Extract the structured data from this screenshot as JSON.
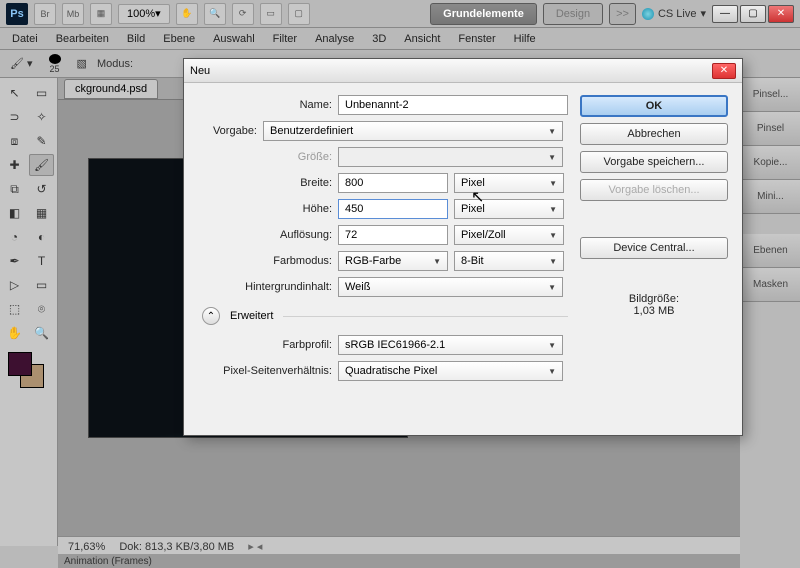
{
  "app": {
    "logo": "Ps",
    "br": "Br",
    "mb": "Mb",
    "zoom": "100%",
    "pill_main": "Grundelemente",
    "pill_design": "Design",
    "chev": ">>",
    "cslive": "CS Live"
  },
  "menus": {
    "datei": "Datei",
    "bearbeiten": "Bearbeiten",
    "bild": "Bild",
    "ebene": "Ebene",
    "auswahl": "Auswahl",
    "filter": "Filter",
    "analyse": "Analyse",
    "dreiD": "3D",
    "ansicht": "Ansicht",
    "fenster": "Fenster",
    "hilfe": "Hilfe"
  },
  "opts": {
    "brush_size": "25",
    "mode": "Modus:"
  },
  "tabs": {
    "doc": "ckground4.psd"
  },
  "panels": {
    "p0": "Pinsel...",
    "p1": "Pinsel",
    "p2": "Kopie...",
    "p3": "Mini...",
    "p4": "Ebenen",
    "p5": "Masken"
  },
  "status": {
    "zoom": "71,63%",
    "doc": "Dok: 813,3 KB/3,80 MB"
  },
  "anim": "Animation (Frames)",
  "dlg": {
    "title": "Neu",
    "labels": {
      "name": "Name:",
      "vorgabe": "Vorgabe:",
      "gr": "Größe:",
      "breite": "Breite:",
      "hoehe": "Höhe:",
      "aufl": "Auflösung:",
      "farbm": "Farbmodus:",
      "hg": "Hintergrundinhalt:",
      "erw": "Erweitert",
      "farbprofil": "Farbprofil:",
      "psv": "Pixel-Seitenverhältnis:"
    },
    "vals": {
      "name": "Unbenannt-2",
      "vorgabe": "Benutzerdefiniert",
      "breite": "800",
      "hoehe": "450",
      "aufl": "72",
      "farbm": "RGB-Farbe",
      "bit": "8-Bit",
      "hg": "Weiß",
      "farbprofil": "sRGB IEC61966-2.1",
      "psv": "Quadratische Pixel",
      "unit_px": "Pixel",
      "unit_aufl": "Pixel/Zoll"
    },
    "btns": {
      "ok": "OK",
      "cancel": "Abbrechen",
      "save": "Vorgabe speichern...",
      "del": "Vorgabe löschen...",
      "dc": "Device Central..."
    },
    "sizelabel": "Bildgröße:",
    "sizeval": "1,03 MB"
  }
}
